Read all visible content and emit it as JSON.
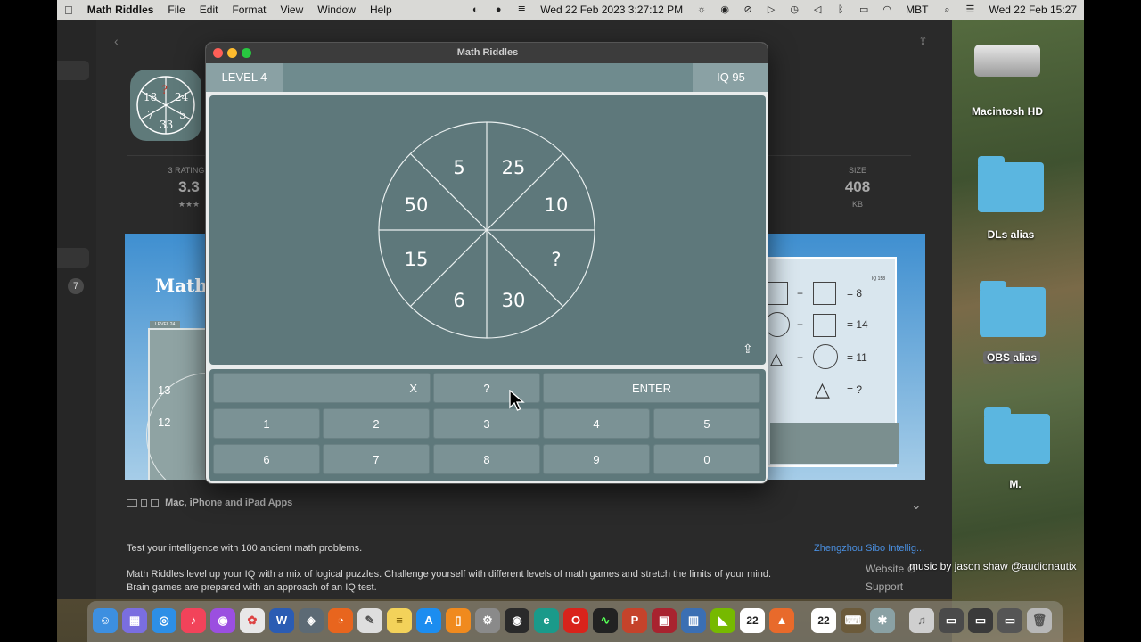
{
  "menubar": {
    "app_name": "Math Riddles",
    "menus": [
      "File",
      "Edit",
      "Format",
      "View",
      "Window",
      "Help"
    ],
    "datetime_left": "Wed 22 Feb 2023  3:27:12 PM",
    "layout_label": "MBT",
    "datetime_right": "Wed 22 Feb  15:27"
  },
  "store": {
    "back_icon": "‹",
    "share_icon": "⇪",
    "stats": {
      "ratings_label": "3 RATINGS",
      "rating_value": "3.3",
      "rating_stars": "★★★",
      "size_label": "SIZE",
      "size_value": "408",
      "size_unit": "KB"
    },
    "badge": "7",
    "screenshot_left_title": "Math",
    "screenshot_left_level": "LEVEL 24",
    "screenshot_left_numbers": [
      "13",
      "12"
    ],
    "screenshot_right_iq": "IQ 158",
    "screenshot_right_equations": [
      "= 8",
      "= 14",
      "= 11",
      "= ?"
    ],
    "screenshot_right_plus": "+",
    "devices_label": "Mac, iPhone and iPad Apps",
    "chevron": "⌄",
    "tagline": "Test your intelligence with 100 ancient math problems.",
    "description": "Math Riddles level up your IQ with a mix of logical puzzles. Challenge yourself with different levels of math games and stretch the limits of your mind. Brain games are prepared with an approach of an IQ test.",
    "developer": "Zhengzhou Sibo Intellig...",
    "website": "Website",
    "support": "Support"
  },
  "music_credit": "music by jason shaw @audionautix",
  "window": {
    "title": "Math Riddles",
    "level": "LEVEL 4",
    "iq": "IQ 95",
    "wheel": [
      "5",
      "25",
      "10",
      "?",
      "30",
      "6",
      "15",
      "50"
    ],
    "share_icon": "⇪",
    "keys_top": {
      "clear": "X",
      "question": "?",
      "enter": "ENTER"
    },
    "keys_row1": [
      "1",
      "2",
      "3",
      "4",
      "5"
    ],
    "keys_row2": [
      "6",
      "7",
      "8",
      "9",
      "0"
    ]
  },
  "desktop": {
    "icons": [
      "Macintosh HD",
      "DLs alias",
      "OBS alias",
      "M."
    ]
  },
  "dock": {
    "calendar_day": "22",
    "calendar_month": "FEB"
  },
  "colors": {
    "board": "#5e787b",
    "key": "#7b9295",
    "header_accent": "#8aa1a4"
  }
}
